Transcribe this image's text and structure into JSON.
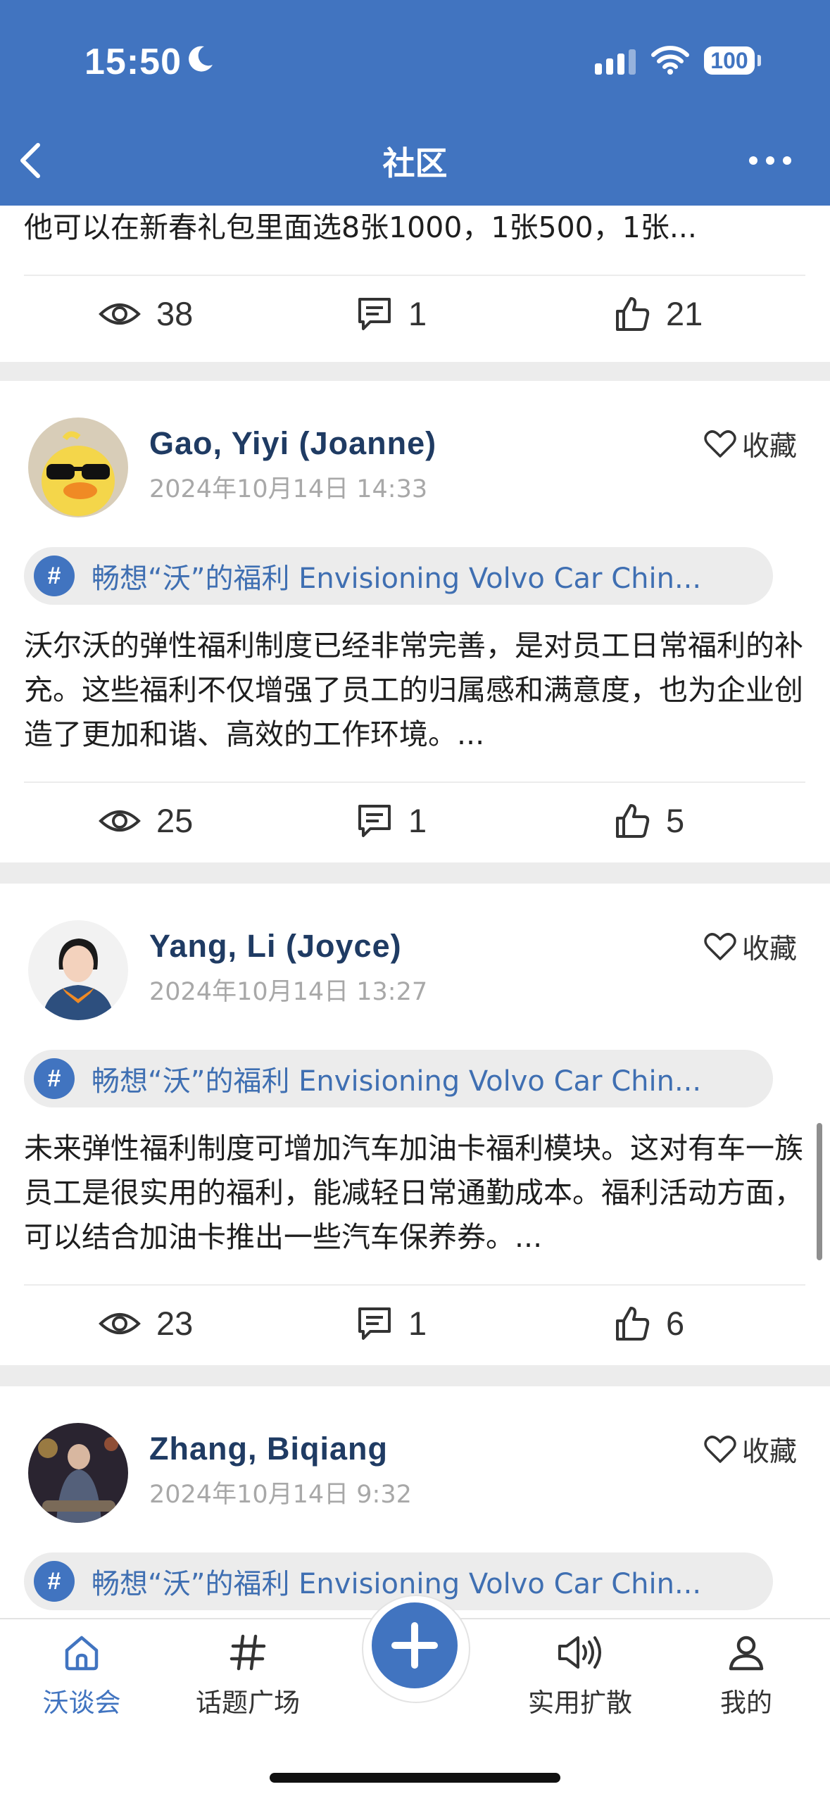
{
  "status_bar": {
    "time": "15:50",
    "battery": "100"
  },
  "nav": {
    "title": "社区"
  },
  "top_card": {
    "excerpt": "他可以在新春礼包里面选8张1000，1张500，1张...",
    "views": "38",
    "comments": "1",
    "likes": "21"
  },
  "posts": [
    {
      "author": "Gao, Yiyi (Joanne)",
      "date": "2024年10月14日 14:33",
      "favorite_label": "收藏",
      "topic": "畅想“沃”的福利 Envisioning Volvo Car Chin...",
      "text": "沃尔沃的弹性福利制度已经非常完善，是对员工日常福利的补充。这些福利不仅增强了员工的归属感和满意度，也为企业创造了更加和谐、高效的工作环境。...",
      "views": "25",
      "comments": "1",
      "likes": "5"
    },
    {
      "author": "Yang, Li (Joyce)",
      "date": "2024年10月14日 13:27",
      "favorite_label": "收藏",
      "topic": "畅想“沃”的福利 Envisioning Volvo Car Chin...",
      "text": "未来弹性福利制度可增加汽车加油卡福利模块。这对有车一族员工是很实用的福利，能减轻日常通勤成本。福利活动方面，可以结合加油卡推出一些汽车保养券。...",
      "views": "23",
      "comments": "1",
      "likes": "6"
    },
    {
      "author": "Zhang, Biqiang",
      "date": "2024年10月14日 9:32",
      "favorite_label": "收藏",
      "topic": "畅想“沃”的福利 Envisioning Volvo Car Chin..."
    }
  ],
  "tabbar": {
    "items": [
      {
        "label": "沃谈会",
        "icon": "home-icon"
      },
      {
        "label": "话题广场",
        "icon": "hash-icon"
      },
      {
        "label": "实用扩散",
        "icon": "speaker-icon"
      },
      {
        "label": "我的",
        "icon": "person-icon"
      }
    ]
  },
  "colors": {
    "brand": "#4174c0",
    "author": "#1f3b63",
    "topic_text": "#3f6fb2"
  }
}
